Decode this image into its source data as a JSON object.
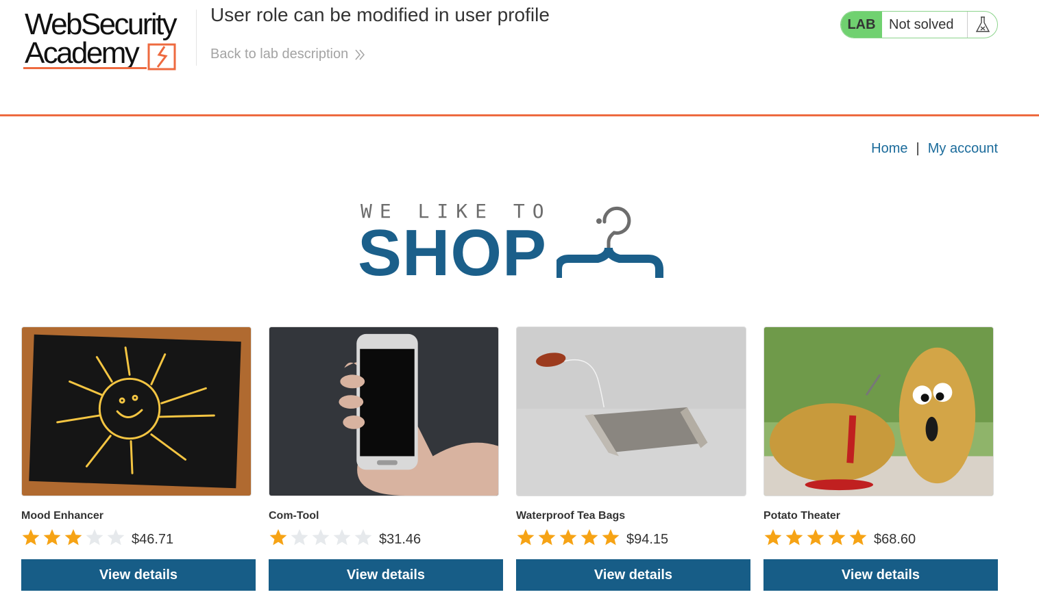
{
  "header": {
    "logo_line1": "WebSecurity",
    "logo_line2": "Academy",
    "lab_title": "User role can be modified in user profile",
    "back_link": "Back to lab description",
    "lab_badge": "LAB",
    "lab_state": "Not solved"
  },
  "nav": {
    "home": "Home",
    "separator": "|",
    "account": "My account"
  },
  "banner": {
    "small": "WE LIKE TO",
    "big": "SHOP"
  },
  "products": [
    {
      "name": "Mood Enhancer",
      "rating": 3,
      "max_rating": 5,
      "price": "$46.71",
      "button": "View details",
      "image": "sun-chalkboard"
    },
    {
      "name": "Com-Tool",
      "rating": 1,
      "max_rating": 5,
      "price": "$31.46",
      "button": "View details",
      "image": "hand-phone"
    },
    {
      "name": "Waterproof Tea Bags",
      "rating": 5,
      "max_rating": 5,
      "price": "$94.15",
      "button": "View details",
      "image": "tea-bag"
    },
    {
      "name": "Potato Theater",
      "rating": 5,
      "max_rating": 5,
      "price": "$68.60",
      "button": "View details",
      "image": "potatoes"
    }
  ],
  "colors": {
    "accent_orange": "#ee6a3f",
    "link_blue": "#1b6b9b",
    "button_blue": "#175d87",
    "lab_green": "#70d170",
    "star_gold": "#f6a315",
    "star_empty": "#e6e9ec"
  }
}
